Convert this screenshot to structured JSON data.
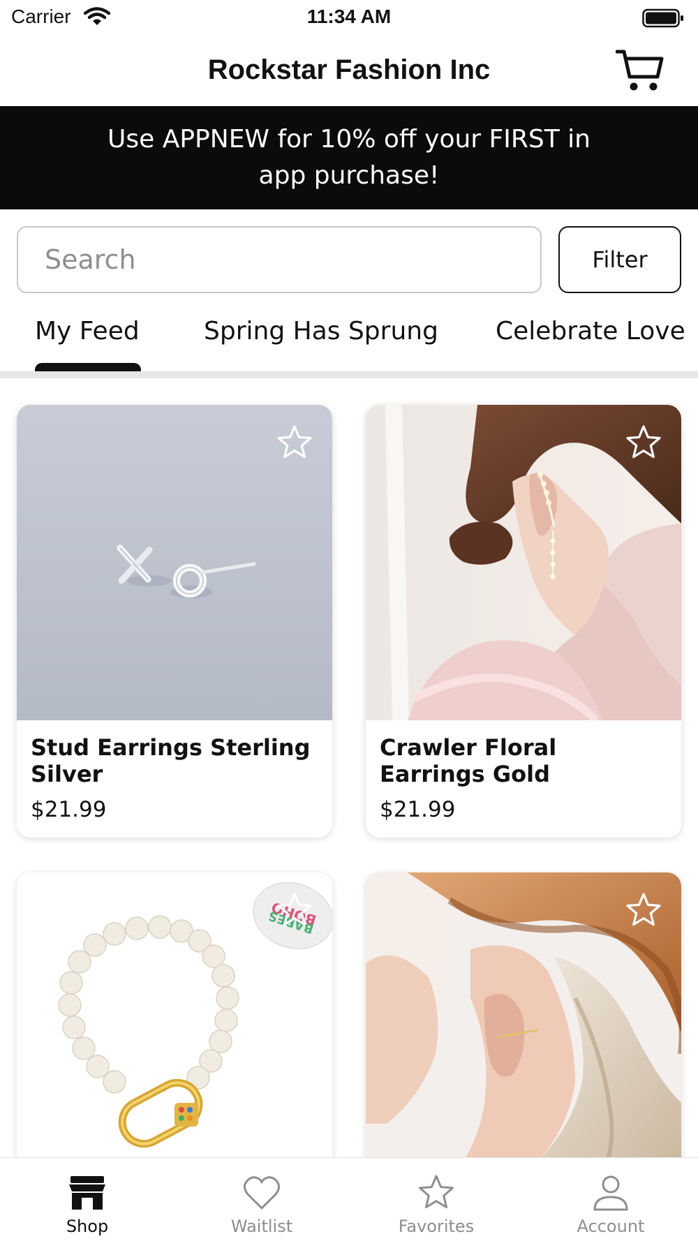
{
  "status_bar": {
    "carrier": "Carrier",
    "time": "11:34 AM"
  },
  "nav": {
    "title": "Rockstar Fashion Inc",
    "cart_icon": "cart-icon"
  },
  "promo": {
    "text": "Use APPNEW for 10% off your FIRST in app purchase!"
  },
  "search": {
    "placeholder": "Search",
    "value": ""
  },
  "filter": {
    "label": "Filter"
  },
  "category_tabs": [
    {
      "label": "My Feed",
      "selected": true
    },
    {
      "label": "Spring Has Sprung",
      "selected": false
    },
    {
      "label": "Celebrate Love",
      "selected": false
    }
  ],
  "products": [
    {
      "name": "Stud Earrings Sterling Silver",
      "price": "$21.99",
      "favorite": false
    },
    {
      "name": "Crawler Floral Earrings Gold",
      "price": "$21.99",
      "favorite": false
    },
    {
      "name": "",
      "price": "",
      "favorite": false,
      "tag_text": "BOHO BABES"
    },
    {
      "name": "",
      "price": "",
      "favorite": false
    }
  ],
  "bottom_tabs": [
    {
      "label": "Shop",
      "icon": "storefront-icon",
      "active": true
    },
    {
      "label": "Waitlist",
      "icon": "heart-icon",
      "active": false
    },
    {
      "label": "Favorites",
      "icon": "star-icon",
      "active": false
    },
    {
      "label": "Account",
      "icon": "person-icon",
      "active": false
    }
  ],
  "colors": {
    "accent": "#111111",
    "promo_bg": "#0b0b0b",
    "inactive": "#8e8e8e",
    "divider": "#e6e6e6"
  }
}
